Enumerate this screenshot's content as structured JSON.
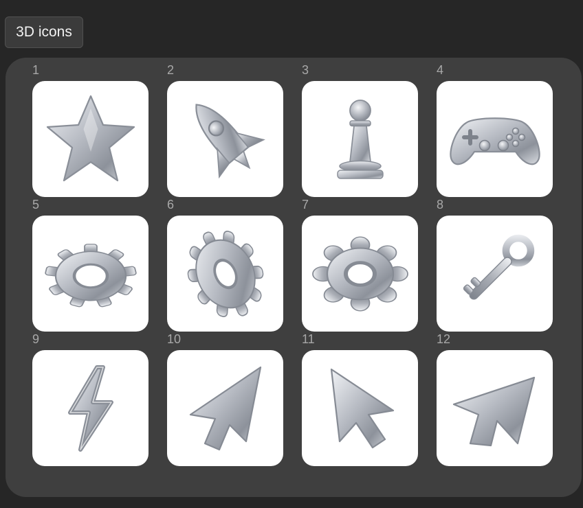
{
  "header": {
    "button_label": "3D icons"
  },
  "icons": [
    {
      "number": "1",
      "icon": "star-icon"
    },
    {
      "number": "2",
      "icon": "rocket-icon"
    },
    {
      "number": "3",
      "icon": "chess-pawn-icon"
    },
    {
      "number": "4",
      "icon": "game-controller-icon"
    },
    {
      "number": "5",
      "icon": "gear-icon"
    },
    {
      "number": "6",
      "icon": "gear-tilted-icon"
    },
    {
      "number": "7",
      "icon": "gear-donut-icon"
    },
    {
      "number": "8",
      "icon": "key-icon"
    },
    {
      "number": "9",
      "icon": "lightning-bolt-icon"
    },
    {
      "number": "10",
      "icon": "cursor-arrow-icon"
    },
    {
      "number": "11",
      "icon": "cursor-arrow-icon"
    },
    {
      "number": "12",
      "icon": "cursor-arrow-tilted-icon"
    }
  ],
  "colors": {
    "background": "#262626",
    "panel": "#3f3f3f",
    "tile": "#ffffff",
    "number": "#a8a8a8",
    "chrome": "#b4b8bf"
  }
}
